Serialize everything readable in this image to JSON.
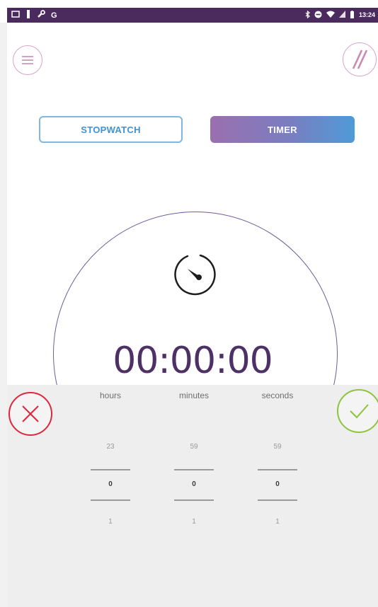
{
  "status_bar": {
    "time": "13:24",
    "left_icons": [
      "screen-icon",
      "usb-icon",
      "wrench-icon",
      "google-icon"
    ],
    "right_icons": [
      "bluetooth-icon",
      "do-not-disturb-icon",
      "wifi-icon",
      "signal-icon",
      "battery-icon"
    ],
    "g_label": "G"
  },
  "header": {
    "menu_icon": "hamburger-menu-icon",
    "brand_icon": "double-slash-logo-icon"
  },
  "mode_switch": {
    "stopwatch_label": "STOPWATCH",
    "timer_label": "TIMER",
    "active": "TIMER"
  },
  "timer": {
    "display": "00:00:00",
    "icon": "timer-dial-icon"
  },
  "picker": {
    "hours": {
      "label": "hours",
      "prev": "23",
      "current": "0",
      "next": "1"
    },
    "minutes": {
      "label": "minutes",
      "prev": "59",
      "current": "0",
      "next": "1"
    },
    "seconds": {
      "label": "seconds",
      "prev": "59",
      "current": "0",
      "next": "1"
    },
    "cancel_icon": "close-icon",
    "confirm_icon": "check-icon"
  },
  "colors": {
    "status_bar": "#4b2a5e",
    "accent_purple": "#4e2f66",
    "accent_blue": "#3f93d4",
    "cancel_red": "#e0263d",
    "confirm_green": "#8cc43c"
  }
}
